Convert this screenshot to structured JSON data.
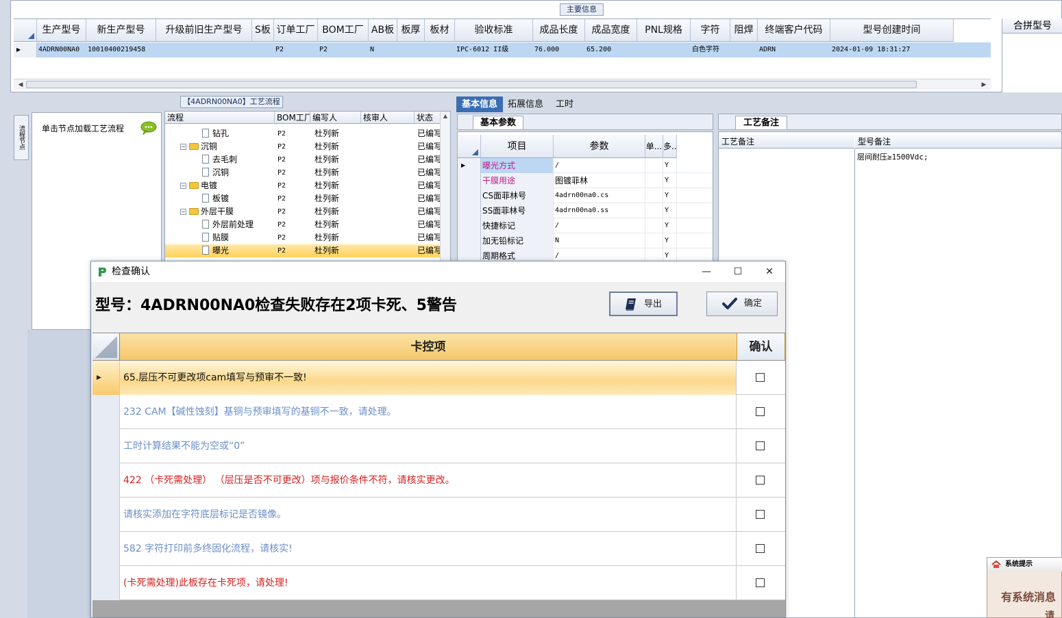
{
  "main_info": {
    "title": "主要信息",
    "columns": [
      "生产型号",
      "新生产型号",
      "升级前旧生产型号",
      "S板",
      "订单工厂",
      "BOM工厂",
      "AB板",
      "板厚",
      "板材",
      "验收标准",
      "成品长度",
      "成品宽度",
      "PNL规格",
      "字符",
      "阻焊",
      "终端客户代码",
      "型号创建时间"
    ],
    "row": [
      "4ADRN00NA0",
      "10010400219458",
      "",
      "",
      "P2",
      "P2",
      "N",
      "",
      "",
      "IPC-6012 II级",
      "76.000",
      "65.200",
      "",
      "白色字符",
      "",
      "ADRN",
      "2024-01-09 18:31:27"
    ],
    "merge_header": "合拼型号"
  },
  "left_panel": {
    "vertical_tab": "流程节点",
    "hint": "单击节点加载工艺流程"
  },
  "flow_panel": {
    "title": "【4ADRN00NA0】工艺流程",
    "columns": [
      "流程",
      "BOM工厂",
      "编写人",
      "核审人",
      "状态"
    ],
    "rows": [
      {
        "name": "钻孔",
        "level": 2,
        "type": "doc",
        "bom": "P2",
        "writer": "杜列新",
        "reviewer": "",
        "status": "已编写"
      },
      {
        "name": "沉铜",
        "level": 1,
        "type": "folder",
        "bom": "P2",
        "writer": "杜列新",
        "reviewer": "",
        "status": "已编写"
      },
      {
        "name": "去毛刺",
        "level": 2,
        "type": "doc",
        "bom": "P2",
        "writer": "杜列新",
        "reviewer": "",
        "status": "已编写"
      },
      {
        "name": "沉铜",
        "level": 2,
        "type": "doc",
        "bom": "P2",
        "writer": "杜列新",
        "reviewer": "",
        "status": "已编写"
      },
      {
        "name": "电镀",
        "level": 1,
        "type": "folder",
        "bom": "P2",
        "writer": "杜列新",
        "reviewer": "",
        "status": "已编写"
      },
      {
        "name": "板镀",
        "level": 2,
        "type": "doc",
        "bom": "P2",
        "writer": "杜列新",
        "reviewer": "",
        "status": "已编写"
      },
      {
        "name": "外层干膜",
        "level": 1,
        "type": "folder",
        "bom": "P2",
        "writer": "杜列新",
        "reviewer": "",
        "status": "已编写"
      },
      {
        "name": "外层前处理",
        "level": 2,
        "type": "doc",
        "bom": "P2",
        "writer": "杜列新",
        "reviewer": "",
        "status": "已编写"
      },
      {
        "name": "贴膜",
        "level": 2,
        "type": "doc",
        "bom": "P2",
        "writer": "杜列新",
        "reviewer": "",
        "status": "已编写"
      },
      {
        "name": "曝光",
        "level": 2,
        "type": "doc",
        "bom": "P2",
        "writer": "杜列新",
        "reviewer": "",
        "status": "已编写",
        "selected": true
      }
    ]
  },
  "mid_tabs": [
    "基本信息",
    "拓展信息",
    "工时"
  ],
  "basic_params": {
    "sub_tab": "基本参数",
    "columns": [
      "项目",
      "参数",
      "单...",
      "多..."
    ],
    "rows": [
      {
        "item": "曝光方式",
        "value": "/",
        "unit": "",
        "multi": "Y",
        "highlight": true
      },
      {
        "item": "干膜用途",
        "value": "图镀菲林",
        "unit": "",
        "multi": "Y",
        "highlight": true
      },
      {
        "item": "CS面菲林号",
        "value": "4adrn00na0.cs",
        "unit": "",
        "multi": "Y"
      },
      {
        "item": "SS面菲林号",
        "value": "4adrn00na0.ss",
        "unit": "",
        "multi": "Y"
      },
      {
        "item": "快捷标记",
        "value": "/",
        "unit": "",
        "multi": "Y"
      },
      {
        "item": "加无铅标记",
        "value": "N",
        "unit": "",
        "multi": "Y"
      },
      {
        "item": "周期格式",
        "value": "/",
        "unit": "",
        "multi": "Y"
      }
    ]
  },
  "remarks": {
    "sub_tab": "工艺备注",
    "col1": "工艺备注",
    "col2": "型号备注",
    "model_remark": "层间耐压≥1500Vdc;"
  },
  "system_tip": {
    "title": "系统提示",
    "message": "有系统消息",
    "message2": "请"
  },
  "dialog": {
    "title": "检查确认",
    "header": "型号：4ADRN00NA0检查失败存在2项卡死、5警告",
    "export_label": "导出",
    "ok_label": "确定",
    "col_item": "卡控项",
    "col_confirm": "确认",
    "rows": [
      {
        "text": "65.层压不可更改项cam填写与预审不一致!",
        "color": "#111111",
        "selected": true
      },
      {
        "text": "232 CAM【碱性蚀刻】基铜与预审填写的基铜不一致，请处理。",
        "color": "#6b8fc8"
      },
      {
        "text": "工时计算结果不能为空或“0”",
        "color": "#6b8fc8"
      },
      {
        "text": "422 （卡死需处理） （层压是否不可更改）项与报价条件不符，请核实更改。",
        "color": "#d81e1e"
      },
      {
        "text": "请核实添加在字符底层标记是否镜像。",
        "color": "#6b8fc8"
      },
      {
        "text": "582 字符打印前多终固化流程，请核实!",
        "color": "#6b8fc8"
      },
      {
        "text": "(卡死需处理)此板存在卡死项，请处理!",
        "color": "#d81e1e"
      }
    ]
  }
}
